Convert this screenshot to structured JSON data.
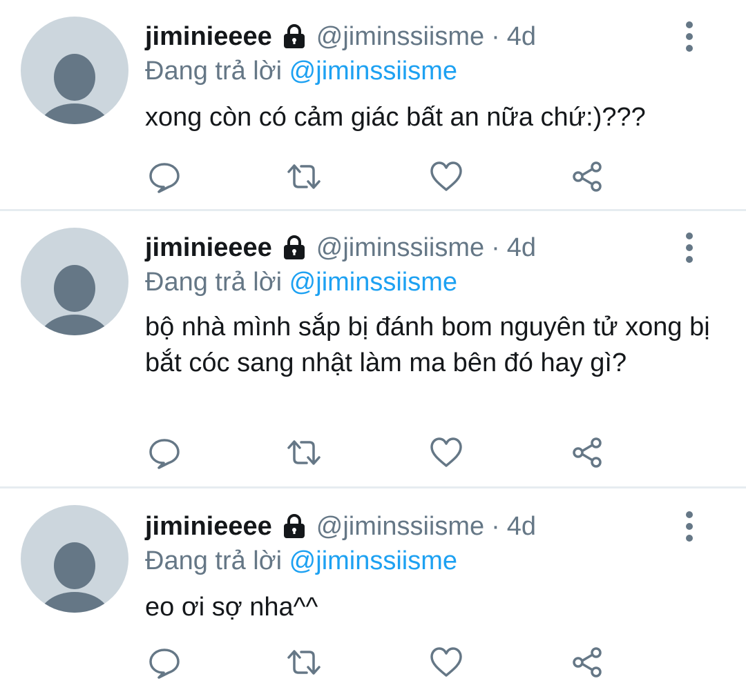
{
  "tweets": [
    {
      "display_name": "jiminieeee",
      "handle": "@jiminssiisme",
      "separator": "·",
      "time": "4d",
      "reply_prefix": "Đang trả lời",
      "reply_to": "@jiminssiisme",
      "text": "xong còn có cảm giác bất an nữa chứ:)???"
    },
    {
      "display_name": "jiminieeee",
      "handle": "@jiminssiisme",
      "separator": "·",
      "time": "4d",
      "reply_prefix": "Đang trả lời",
      "reply_to": "@jiminssiisme",
      "text": "bộ nhà mình sắp bị đánh bom nguyên tử xong bị bắt cóc sang nhật làm ma bên đó hay gì?"
    },
    {
      "display_name": "jiminieeee",
      "handle": "@jiminssiisme",
      "separator": "·",
      "time": "4d",
      "reply_prefix": "Đang trả lời",
      "reply_to": "@jiminssiisme",
      "text": "eo ơi sợ nha^^"
    }
  ],
  "icons": {
    "lock": "lock-icon",
    "more": "more-vertical-icon",
    "reply": "reply-icon",
    "retweet": "retweet-icon",
    "like": "heart-icon",
    "share": "share-icon"
  },
  "colors": {
    "accent": "#1da1f2",
    "secondary_text": "#657786",
    "primary_text": "#14171a",
    "avatar_bg": "#ccd6dd",
    "avatar_fg": "#657786",
    "divider": "#e6ecf0"
  }
}
